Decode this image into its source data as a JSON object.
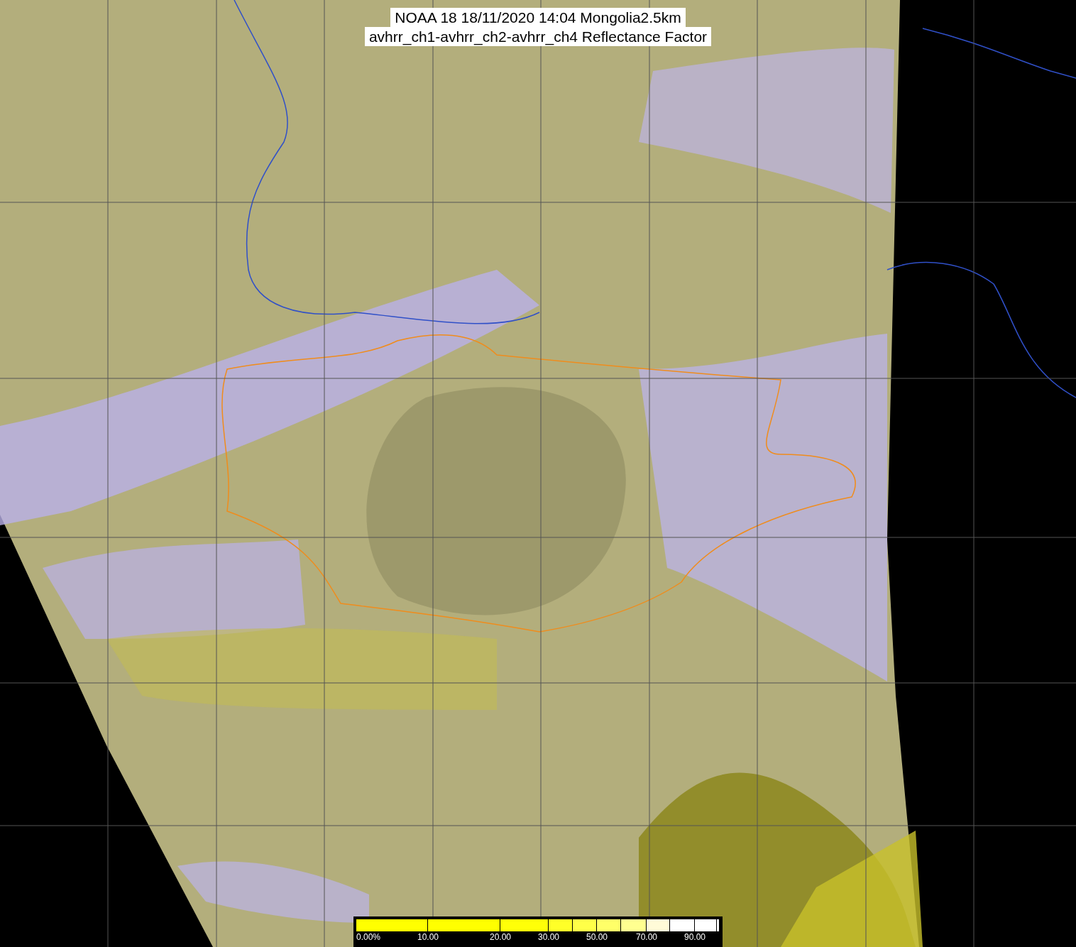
{
  "title": {
    "lines": [
      "NOAA 18 18/11/2020 14:04 Mongolia2.5km",
      "avhrr_ch1-avhrr_ch2-avhrr_ch4 Reflectance Factor"
    ]
  },
  "colorbar": {
    "segments": [
      {
        "color": "#ffff00"
      },
      {
        "color": "#ffff00"
      },
      {
        "color": "#ffff08"
      },
      {
        "color": "#ffff28"
      },
      {
        "color": "#ffff48"
      },
      {
        "color": "#ffff68"
      },
      {
        "color": "#ffff90"
      },
      {
        "color": "#fffbd8"
      },
      {
        "color": "#ffffff"
      },
      {
        "color": "#ffffff"
      },
      {
        "color": "#ffffff"
      }
    ],
    "labels": [
      "0.00%",
      "10.00",
      "20.00",
      "30.00",
      "50.00",
      "70.00",
      "90.00"
    ]
  }
}
